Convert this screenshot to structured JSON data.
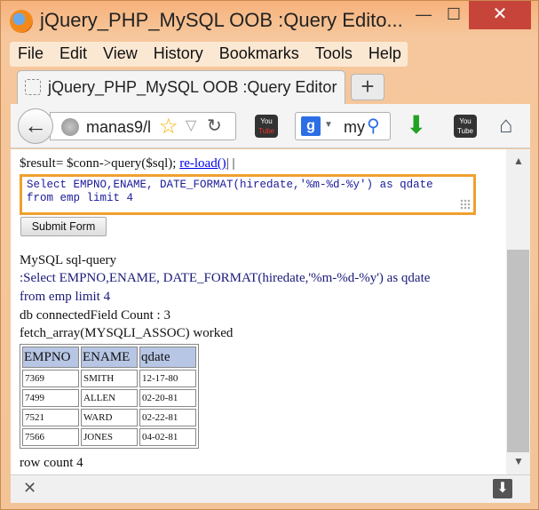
{
  "window": {
    "title": "jQuery_PHP_MySQL OOB :Query Edito...",
    "minimize": "—",
    "maximize": "☐",
    "close": "✕"
  },
  "menu": [
    "File",
    "Edit",
    "View",
    "History",
    "Bookmarks",
    "Tools",
    "Help"
  ],
  "tab": {
    "label": "jQuery_PHP_MySQL OOB :Query Editor",
    "new_tab": "+"
  },
  "nav": {
    "url": "manas9/l",
    "search_text": "my",
    "youtube_top": "You",
    "youtube_bottom": "Tube"
  },
  "content": {
    "result_prefix": "$result= $conn->query($sql); ",
    "reload_link": "re-load()",
    "result_suffix": "| |",
    "sql_text": "Select EMPNO,ENAME, DATE_FORMAT(hiredate,'%m-%d-%y') as qdate\nfrom emp limit 4",
    "submit_label": "Submit Form",
    "mysql_label": "MySQL sql-query",
    "query_line1": ":Select EMPNO,ENAME, DATE_FORMAT(hiredate,'%m-%d-%y') as qdate",
    "query_line2": "from emp limit 4",
    "connected_line": "db connectedField Count : 3",
    "fetch_line": "fetch_array(MYSQLI_ASSOC) worked",
    "row_count": "row count 4"
  },
  "table": {
    "headers": [
      "EMPNO",
      "ENAME",
      "qdate"
    ],
    "rows": [
      [
        "7369",
        "SMITH",
        "12-17-80"
      ],
      [
        "7499",
        "ALLEN",
        "02-20-81"
      ],
      [
        "7521",
        "WARD",
        "02-22-81"
      ],
      [
        "7566",
        "JONES",
        "04-02-81"
      ]
    ]
  },
  "colors": {
    "titlebar": "#f7b27c",
    "close": "#c7443a",
    "sql_border": "#f0a030",
    "header_bg": "#b7c6e4",
    "link": "#0000ee"
  }
}
